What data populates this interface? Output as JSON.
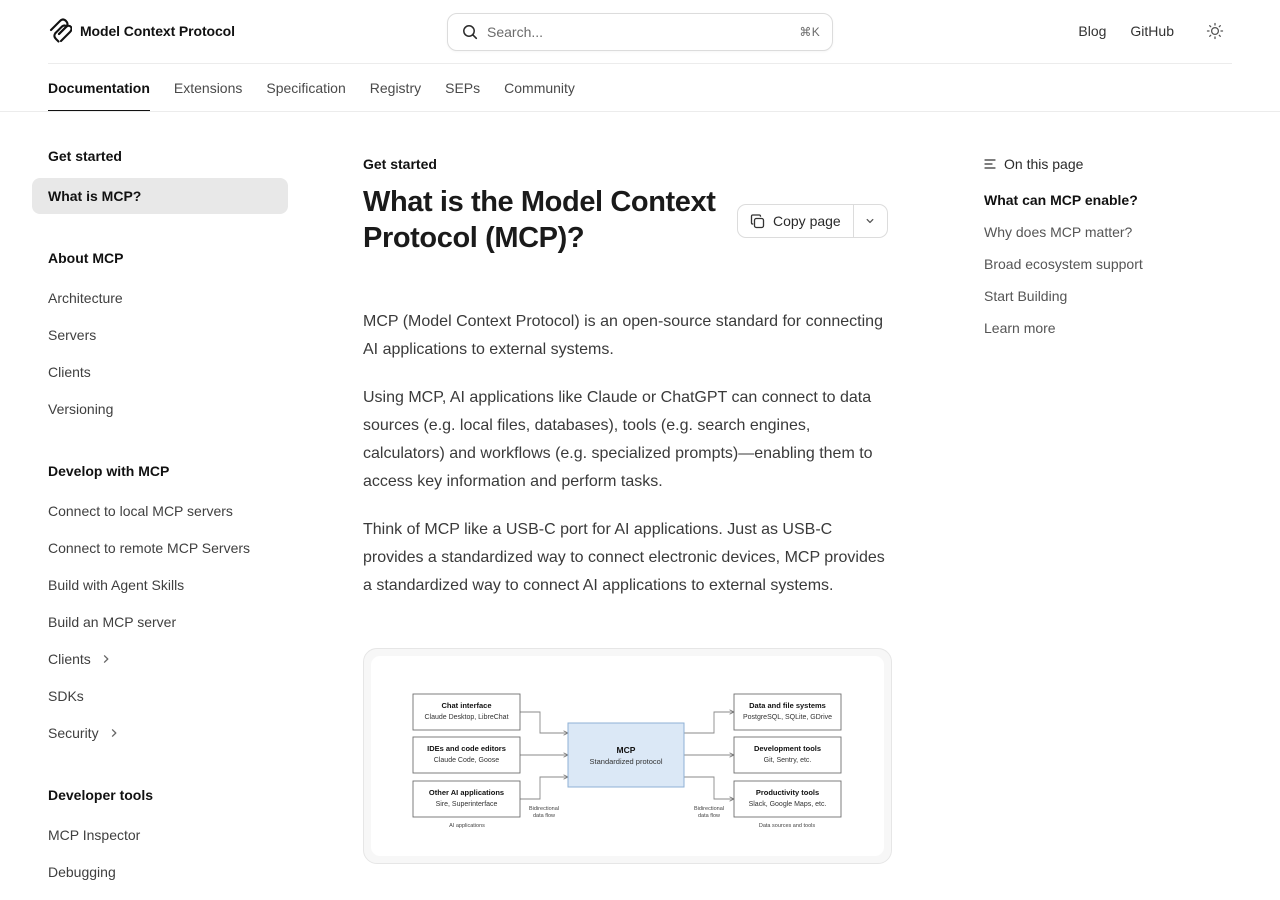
{
  "header": {
    "logo_text": "Model Context Protocol",
    "search_placeholder": "Search...",
    "search_shortcut": "⌘K",
    "links": [
      "Blog",
      "GitHub"
    ],
    "theme_icon": "sun-icon"
  },
  "tabs": [
    "Documentation",
    "Extensions",
    "Specification",
    "Registry",
    "SEPs",
    "Community"
  ],
  "sidebar": {
    "groups": [
      {
        "title": "Get started",
        "items": [
          {
            "label": "What is MCP?"
          }
        ]
      },
      {
        "title": "About MCP",
        "items": [
          {
            "label": "Architecture"
          },
          {
            "label": "Servers"
          },
          {
            "label": "Clients"
          },
          {
            "label": "Versioning"
          }
        ]
      },
      {
        "title": "Develop with MCP",
        "items": [
          {
            "label": "Connect to local MCP servers"
          },
          {
            "label": "Connect to remote MCP Servers"
          },
          {
            "label": "Build with Agent Skills"
          },
          {
            "label": "Build an MCP server"
          },
          {
            "label": "Clients"
          },
          {
            "label": "SDKs"
          },
          {
            "label": "Security"
          }
        ]
      },
      {
        "title": "Developer tools",
        "items": [
          {
            "label": "MCP Inspector"
          },
          {
            "label": "Debugging"
          }
        ]
      }
    ],
    "active_item": "What is MCP?"
  },
  "main": {
    "eyebrow": "Get started",
    "title": "What is the Model Context Protocol (MCP)?",
    "copy_label": "Copy page",
    "paragraphs": [
      "MCP (Model Context Protocol) is an open-source standard for connecting AI applications to external systems.",
      "Using MCP, AI applications like Claude or ChatGPT can connect to data sources (e.g. local files, databases), tools (e.g. search engines, calculators) and workflows (e.g. specialized prompts)—enabling them to access key information and perform tasks.",
      "Think of MCP like a USB-C port for AI applications. Just as USB-C provides a standardized way to connect electronic devices, MCP provides a standardized way to connect AI applications to external systems."
    ],
    "diagram": {
      "left": [
        {
          "title": "Chat interface",
          "sub": "Claude Desktop, LibreChat"
        },
        {
          "title": "IDEs and code editors",
          "sub": "Claude Code, Goose"
        },
        {
          "title": "Other AI applications",
          "sub": "Sire, Superinterface"
        }
      ],
      "center": {
        "title": "MCP",
        "sub": "Standardized protocol"
      },
      "right": [
        {
          "title": "Data and file systems",
          "sub": "PostgreSQL, SQLite, GDrive"
        },
        {
          "title": "Development tools",
          "sub": "Git, Sentry, etc."
        },
        {
          "title": "Productivity tools",
          "sub": "Slack, Google Maps, etc."
        }
      ],
      "flow_label_1": "Bidirectional",
      "flow_label_2": "data flow",
      "left_caption": "AI applications",
      "right_caption": "Data sources and tools",
      "center_fill": "#dbe8f6",
      "center_stroke": "#8fb1d6"
    }
  },
  "toc": {
    "title": "On this page",
    "items": [
      "What can MCP enable?",
      "Why does MCP matter?",
      "Broad ecosystem support",
      "Start Building",
      "Learn more"
    ],
    "active": "What can MCP enable?"
  }
}
